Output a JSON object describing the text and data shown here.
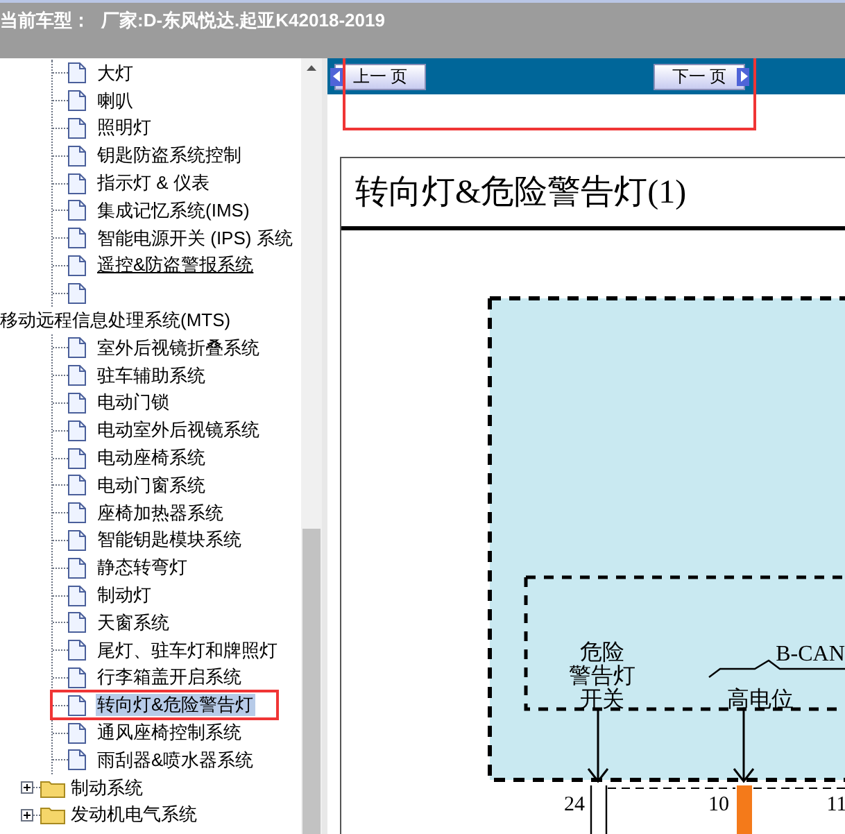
{
  "header": {
    "label": "当前车型：",
    "vehicle": "厂家:D-东风悦达.起亚K42018-2019"
  },
  "tree": [
    {
      "children": [
        {
          "kind": "page",
          "label": "大灯",
          "selected": false
        },
        {
          "kind": "page",
          "label": "喇叭",
          "selected": false
        },
        {
          "kind": "page",
          "label": "照明灯",
          "selected": false
        },
        {
          "kind": "page",
          "label": "钥匙防盗系统控制",
          "selected": false
        },
        {
          "kind": "page",
          "label": "指示灯 & 仪表",
          "selected": false
        },
        {
          "kind": "page",
          "label": "集成记忆系统(IMS)",
          "selected": false
        },
        {
          "kind": "page",
          "label": "智能电源开关 (IPS) 系统",
          "selected": false
        },
        {
          "kind": "page",
          "label": "遥控&防盗警报系统",
          "selected": false,
          "hovered": true
        },
        {
          "kind": "blank"
        }
      ]
    },
    {
      "label": "移动远程信息处理系统(MTS)",
      "expanded": true,
      "children": [
        {
          "kind": "page",
          "label": "室外后视镜折叠系统",
          "selected": false
        },
        {
          "kind": "page",
          "label": "驻车辅助系统",
          "selected": false
        },
        {
          "kind": "page",
          "label": "电动门锁",
          "selected": false
        },
        {
          "kind": "page",
          "label": "电动室外后视镜系统",
          "selected": false
        },
        {
          "kind": "page",
          "label": "电动座椅系统",
          "selected": false
        },
        {
          "kind": "page",
          "label": "电动门窗系统",
          "selected": false
        },
        {
          "kind": "page",
          "label": "座椅加热器系统",
          "selected": false
        },
        {
          "kind": "page",
          "label": "智能钥匙模块系统",
          "selected": false
        },
        {
          "kind": "page",
          "label": "静态转弯灯",
          "selected": false
        },
        {
          "kind": "page",
          "label": "制动灯",
          "selected": false
        },
        {
          "kind": "page",
          "label": "天窗系统",
          "selected": false
        },
        {
          "kind": "page",
          "label": "尾灯、驻车灯和牌照灯",
          "selected": false
        },
        {
          "kind": "page",
          "label": "行李箱盖开启系统",
          "selected": false
        },
        {
          "kind": "page",
          "label": "转向灯&危险警告灯",
          "selected": true
        },
        {
          "kind": "page",
          "label": "通风座椅控制系统",
          "selected": false
        },
        {
          "kind": "page",
          "label": "雨刮器&喷水器系统",
          "selected": false
        }
      ]
    },
    {
      "label": "制动系统",
      "expanded": false
    },
    {
      "label": "发动机电气系统",
      "expanded": false
    }
  ],
  "nav": {
    "prev": "上一 页",
    "next": "下一 页"
  },
  "document": {
    "title": "转向灯&危险警告灯(1)",
    "diagram": {
      "switch_label": [
        "危险",
        "警告灯",
        "开关"
      ],
      "bus": "B-CAN",
      "high": "高电位",
      "pins": [
        "24",
        "10",
        "11"
      ]
    }
  }
}
